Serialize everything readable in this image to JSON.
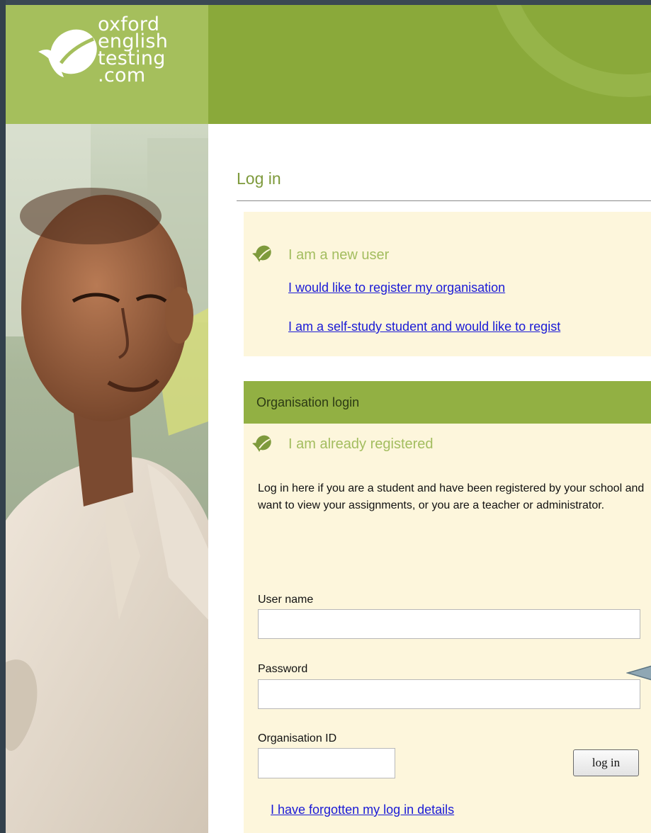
{
  "brand": {
    "logo_lines": [
      "oxford",
      "english",
      "testing",
      ".com"
    ]
  },
  "colors": {
    "brand_green": "#8aa93a",
    "logo_green": "#a5bf5c",
    "panel_cream": "#fdf6dc",
    "heading_green": "#a3bd5f",
    "link_blue": "#1a1ad6"
  },
  "page": {
    "title": "Log in"
  },
  "new_user": {
    "icon": "checkmark-leaf-icon",
    "heading": "I am a new user",
    "links": [
      "I would like to register my organisation",
      "I am a self-study student and would like to regist"
    ]
  },
  "org_login": {
    "header": "Organisation login",
    "icon": "checkmark-leaf-icon",
    "heading": "I am already registered",
    "description": "Log in here if you are a student and have been registered by your school and want to view your assignments, or you are a teacher or administrator.",
    "fields": {
      "username_label": "User name",
      "username_value": "",
      "password_label": "Password",
      "password_value": "",
      "org_id_label": "Organisation ID",
      "org_id_value": ""
    },
    "login_button": "log in",
    "forgot_link": "I have forgotten my log in details"
  }
}
